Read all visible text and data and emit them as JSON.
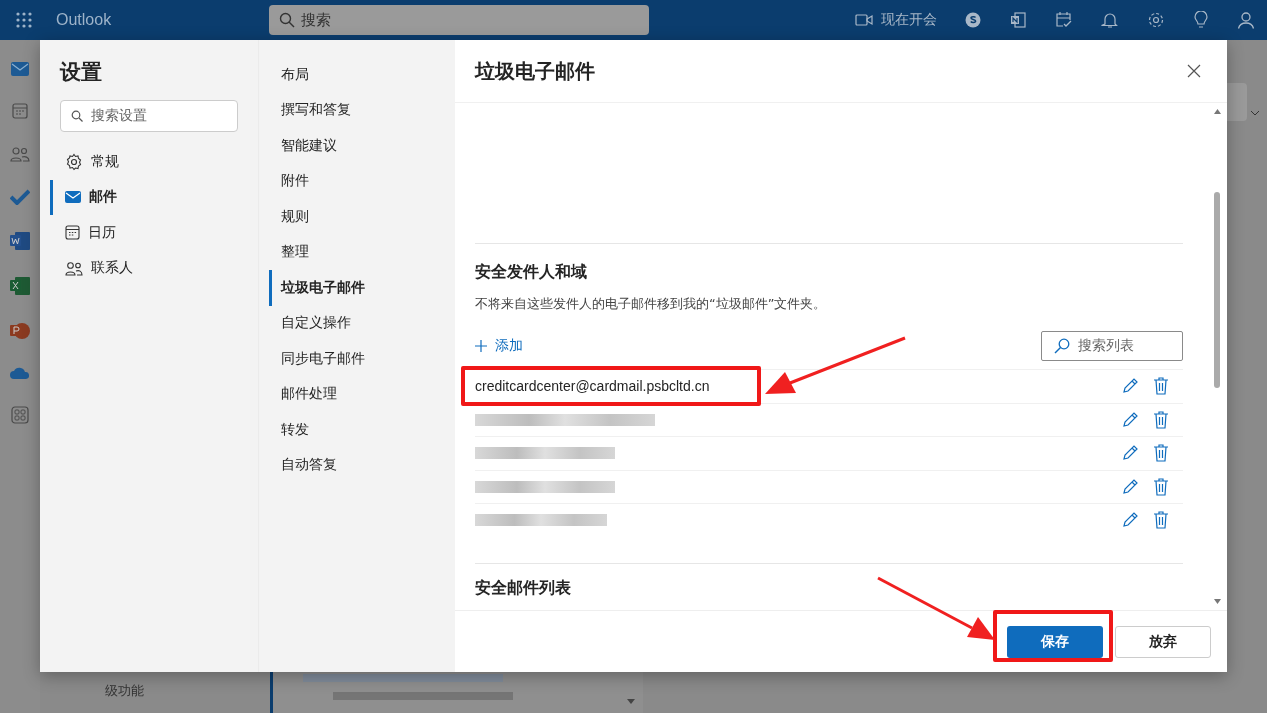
{
  "top_bar": {
    "app_name": "Outlook",
    "search": {
      "placeholder": "搜索"
    },
    "meet_now": "现在开会"
  },
  "background": {
    "promo_text": "级功能"
  },
  "settings": {
    "title": "设置",
    "search": {
      "placeholder": "搜索设置"
    },
    "categories": [
      {
        "label": "常规",
        "selected": false
      },
      {
        "label": "邮件",
        "selected": true
      },
      {
        "label": "日历",
        "selected": false
      },
      {
        "label": "联系人",
        "selected": false
      }
    ],
    "subcategories": [
      {
        "label": "布局",
        "selected": false
      },
      {
        "label": "撰写和答复",
        "selected": false
      },
      {
        "label": "智能建议",
        "selected": false
      },
      {
        "label": "附件",
        "selected": false
      },
      {
        "label": "规则",
        "selected": false
      },
      {
        "label": "整理",
        "selected": false
      },
      {
        "label": "垃圾电子邮件",
        "selected": true
      },
      {
        "label": "自定义操作",
        "selected": false
      },
      {
        "label": "同步电子邮件",
        "selected": false
      },
      {
        "label": "邮件处理",
        "selected": false
      },
      {
        "label": "转发",
        "selected": false
      },
      {
        "label": "自动答复",
        "selected": false
      }
    ],
    "panel": {
      "title": "垃圾电子邮件",
      "section": {
        "title": "安全发件人和域",
        "description": "不将来自这些发件人的电子邮件移到我的“垃圾邮件”文件夹。",
        "add": "添加",
        "search": {
          "placeholder": "搜索列表"
        },
        "entries": [
          {
            "kind": "address",
            "address": "creditcardcenter@cardmail.psbcltd.cn",
            "highlighted": true
          },
          {
            "kind": "redacted",
            "highlighted": false
          },
          {
            "kind": "redacted",
            "highlighted": false
          },
          {
            "kind": "redacted",
            "highlighted": false
          },
          {
            "kind": "redacted",
            "highlighted": false
          }
        ]
      },
      "next_section_title": "安全邮件列表",
      "buttons": [
        {
          "label": "保存",
          "kind": "primary",
          "highlighted": true
        },
        {
          "label": "放弃",
          "kind": "secondary",
          "highlighted": false
        }
      ]
    }
  }
}
